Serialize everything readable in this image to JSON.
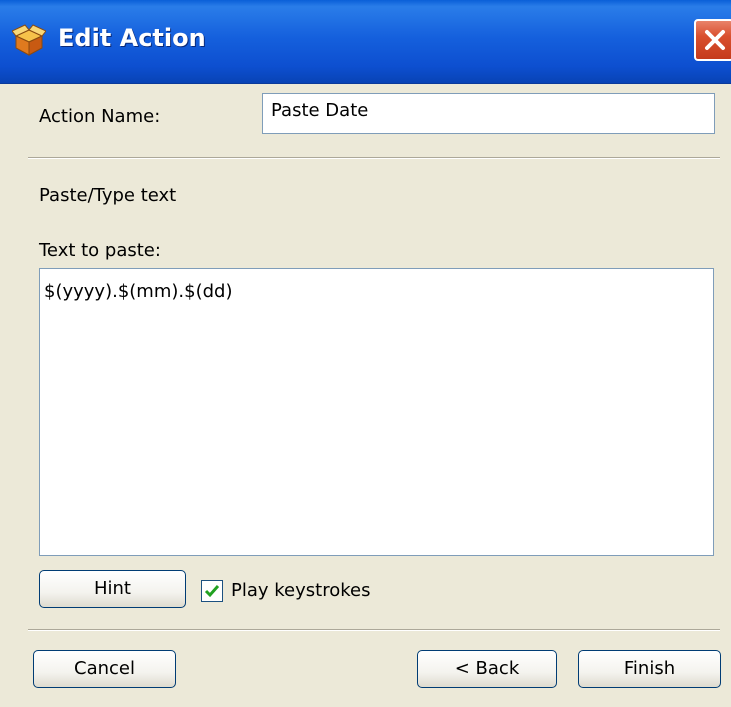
{
  "window": {
    "title": "Edit Action",
    "icon": "wizard-box-icon",
    "close_icon": "close-icon"
  },
  "form": {
    "action_name_label": "Action Name:",
    "action_name_value": "Paste Date",
    "section_heading": "Paste/Type text",
    "text_to_paste_label": "Text to paste:",
    "text_to_paste_value": "$(yyyy).$(mm).$(dd)",
    "hint_label": "Hint",
    "play_keystrokes_label": "Play keystrokes",
    "play_keystrokes_checked": true
  },
  "footer": {
    "cancel_label": "Cancel",
    "back_label": "< Back",
    "finish_label": "Finish"
  },
  "colors": {
    "titlebar": "#0d55d6",
    "dialog_background": "#ece9d8",
    "close_button": "#d9502f",
    "checkmark": "#21a121"
  }
}
